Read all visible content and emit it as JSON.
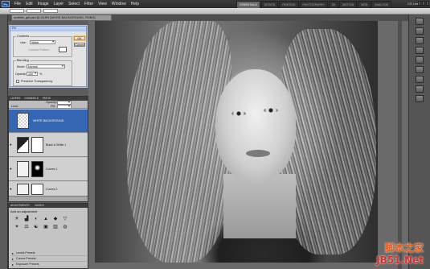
{
  "window": {
    "menu": [
      "File",
      "Edit",
      "Image",
      "Layer",
      "Select",
      "Filter",
      "View",
      "Window",
      "Help"
    ],
    "workspaces": [
      "ESSENTIALS",
      "DESIGN",
      "PAINTING",
      "PHOTOGRAPHY",
      "3D",
      "MOTION",
      "WEB",
      "ANALYSIS"
    ],
    "cs_live": "CS Live"
  },
  "document": {
    "tab_title": "scribble_girl.psd @ 25.8% (WHITE BACKGROUND, RGB/8)"
  },
  "fill_dialog": {
    "title": "Fill",
    "contents_label": "Contents",
    "use_label": "Use:",
    "use_value": "White",
    "custom_pattern_label": "Custom Pattern:",
    "blending_label": "Blending",
    "mode_label": "Mode:",
    "mode_value": "Normal",
    "opacity_label": "Opacity:",
    "opacity_value": "100",
    "opacity_unit": "%",
    "preserve_label": "Preserve Transparency",
    "ok_label": "OK",
    "cancel_label": "Cancel"
  },
  "layers_panel": {
    "tabs": [
      "LAYERS",
      "CHANNELS",
      "PATHS"
    ],
    "opacity_label": "Opacity:",
    "fill_label": "Fill:",
    "lock_label": "Lock:",
    "layers": [
      {
        "name": "WHITE BACKGROUND",
        "selected": true
      },
      {
        "name": "Black & White 1",
        "selected": false
      },
      {
        "name": "Curves 1",
        "selected": false
      },
      {
        "name": "Curves 2",
        "selected": false
      }
    ]
  },
  "adjustments_panel": {
    "tabs": [
      "ADJUSTMENTS",
      "MASKS"
    ],
    "title": "Add an adjustment",
    "icons": [
      "☀",
      "▟",
      "◐",
      "▲",
      "◆",
      "▽",
      "✦",
      "⚖",
      "☯",
      "▣",
      "▥",
      "◍"
    ],
    "presets": [
      "Levels Presets",
      "Curves Presets",
      "Exposure Presets"
    ]
  },
  "watermark": {
    "cn": "脚本之家",
    "url": "JB51.Net"
  },
  "colors": {
    "selected_layer": "#3466b3",
    "dialog_title": "#a7c2ea"
  }
}
